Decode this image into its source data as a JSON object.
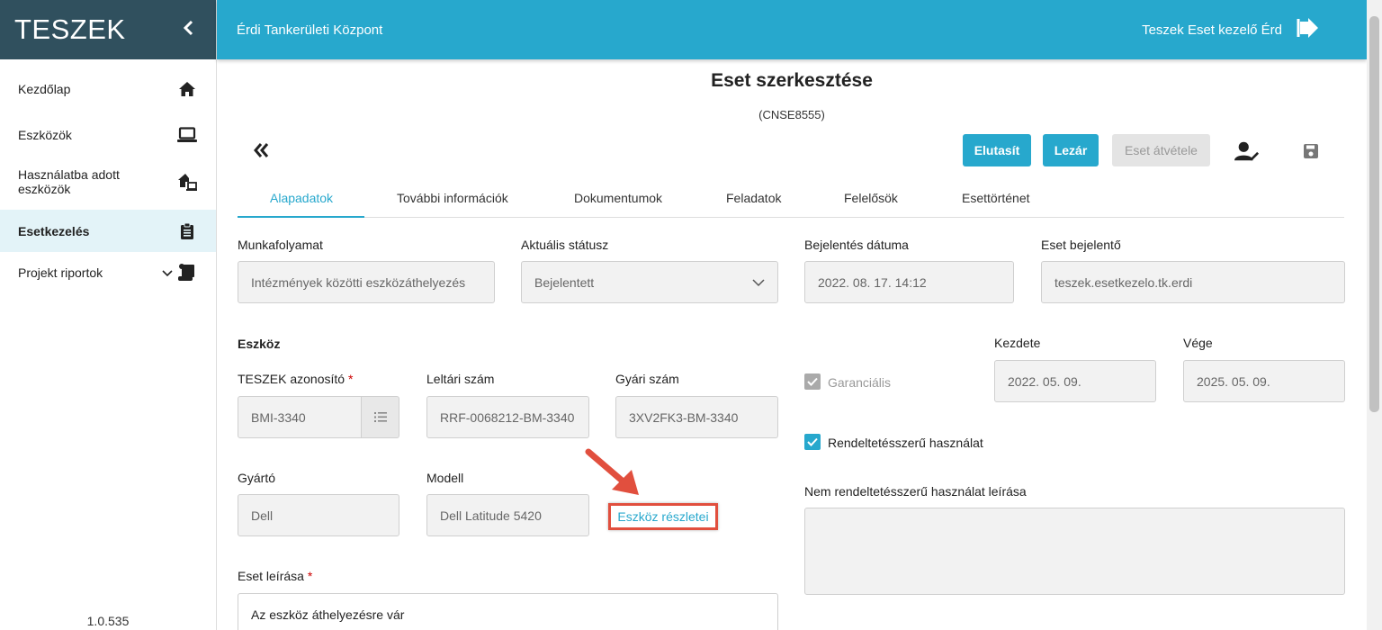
{
  "sidebar": {
    "brand": "TESZEK",
    "collapse_icon": "chevron-left-icon",
    "items": [
      {
        "label": "Kezdőlap",
        "icon": "home-icon"
      },
      {
        "label": "Eszközök",
        "icon": "laptop-icon"
      },
      {
        "label": "Használatba adott eszközök",
        "icon": "house-device-icon"
      },
      {
        "label": "Esetkezelés",
        "icon": "clipboard-icon",
        "active": true
      },
      {
        "label": "Projekt riportok",
        "icon": "scroll-icon",
        "expandable": true
      }
    ],
    "version": "1.0.535"
  },
  "topbar": {
    "org": "Érdi Tankerületi Központ",
    "user": "Teszek Eset kezelő Érd",
    "logout_icon": "sign-out-icon"
  },
  "page": {
    "title": "Eset szerkesztése",
    "case_id": "(CNSE8555)",
    "back_icon": "double-chevron-left-icon"
  },
  "actions": {
    "reject": "Elutasít",
    "close": "Lezár",
    "take_over": "Eset átvétele",
    "assign_icon": "user-edit-icon",
    "save_icon": "save-icon"
  },
  "tabs": [
    {
      "label": "Alapadatok",
      "active": true
    },
    {
      "label": "További információk"
    },
    {
      "label": "Dokumentumok"
    },
    {
      "label": "Feladatok"
    },
    {
      "label": "Felelősök"
    },
    {
      "label": "Esettörténet"
    }
  ],
  "form": {
    "workflow": {
      "label": "Munkafolyamat",
      "value": "Intézmények közötti eszközáthelyezés"
    },
    "status": {
      "label": "Aktuális státusz",
      "value": "Bejelentett"
    },
    "report_date": {
      "label": "Bejelentés dátuma",
      "value": "2022. 08. 17. 14:12"
    },
    "reporter": {
      "label": "Eset bejelentő",
      "value": "teszek.esetkezelo.tk.erdi"
    },
    "device_section": "Eszköz",
    "teszek_id": {
      "label": "TESZEK azonosító",
      "required": "*",
      "value": "BMI-3340"
    },
    "inventory_no": {
      "label": "Leltári szám",
      "value": "RRF-0068212-BM-3340"
    },
    "serial_no": {
      "label": "Gyári szám",
      "value": "3XV2FK3-BM-3340"
    },
    "manufacturer": {
      "label": "Gyártó",
      "value": "Dell"
    },
    "model": {
      "label": "Modell",
      "value": "Dell Latitude 5420"
    },
    "device_details_link": "Eszköz részletei",
    "warranty": {
      "label": "Garanciális",
      "checked": true,
      "disabled": true
    },
    "start": {
      "label": "Kezdete",
      "value": "2022. 05. 09."
    },
    "end": {
      "label": "Vége",
      "value": "2025. 05. 09."
    },
    "intended_use": {
      "label": "Rendeltetésszerű használat",
      "checked": true
    },
    "misuse_desc": {
      "label": "Nem rendeltetésszerű használat leírása",
      "value": ""
    },
    "case_desc": {
      "label": "Eset leírása",
      "required": "*",
      "value": "Az eszköz áthelyezésre vár"
    }
  }
}
